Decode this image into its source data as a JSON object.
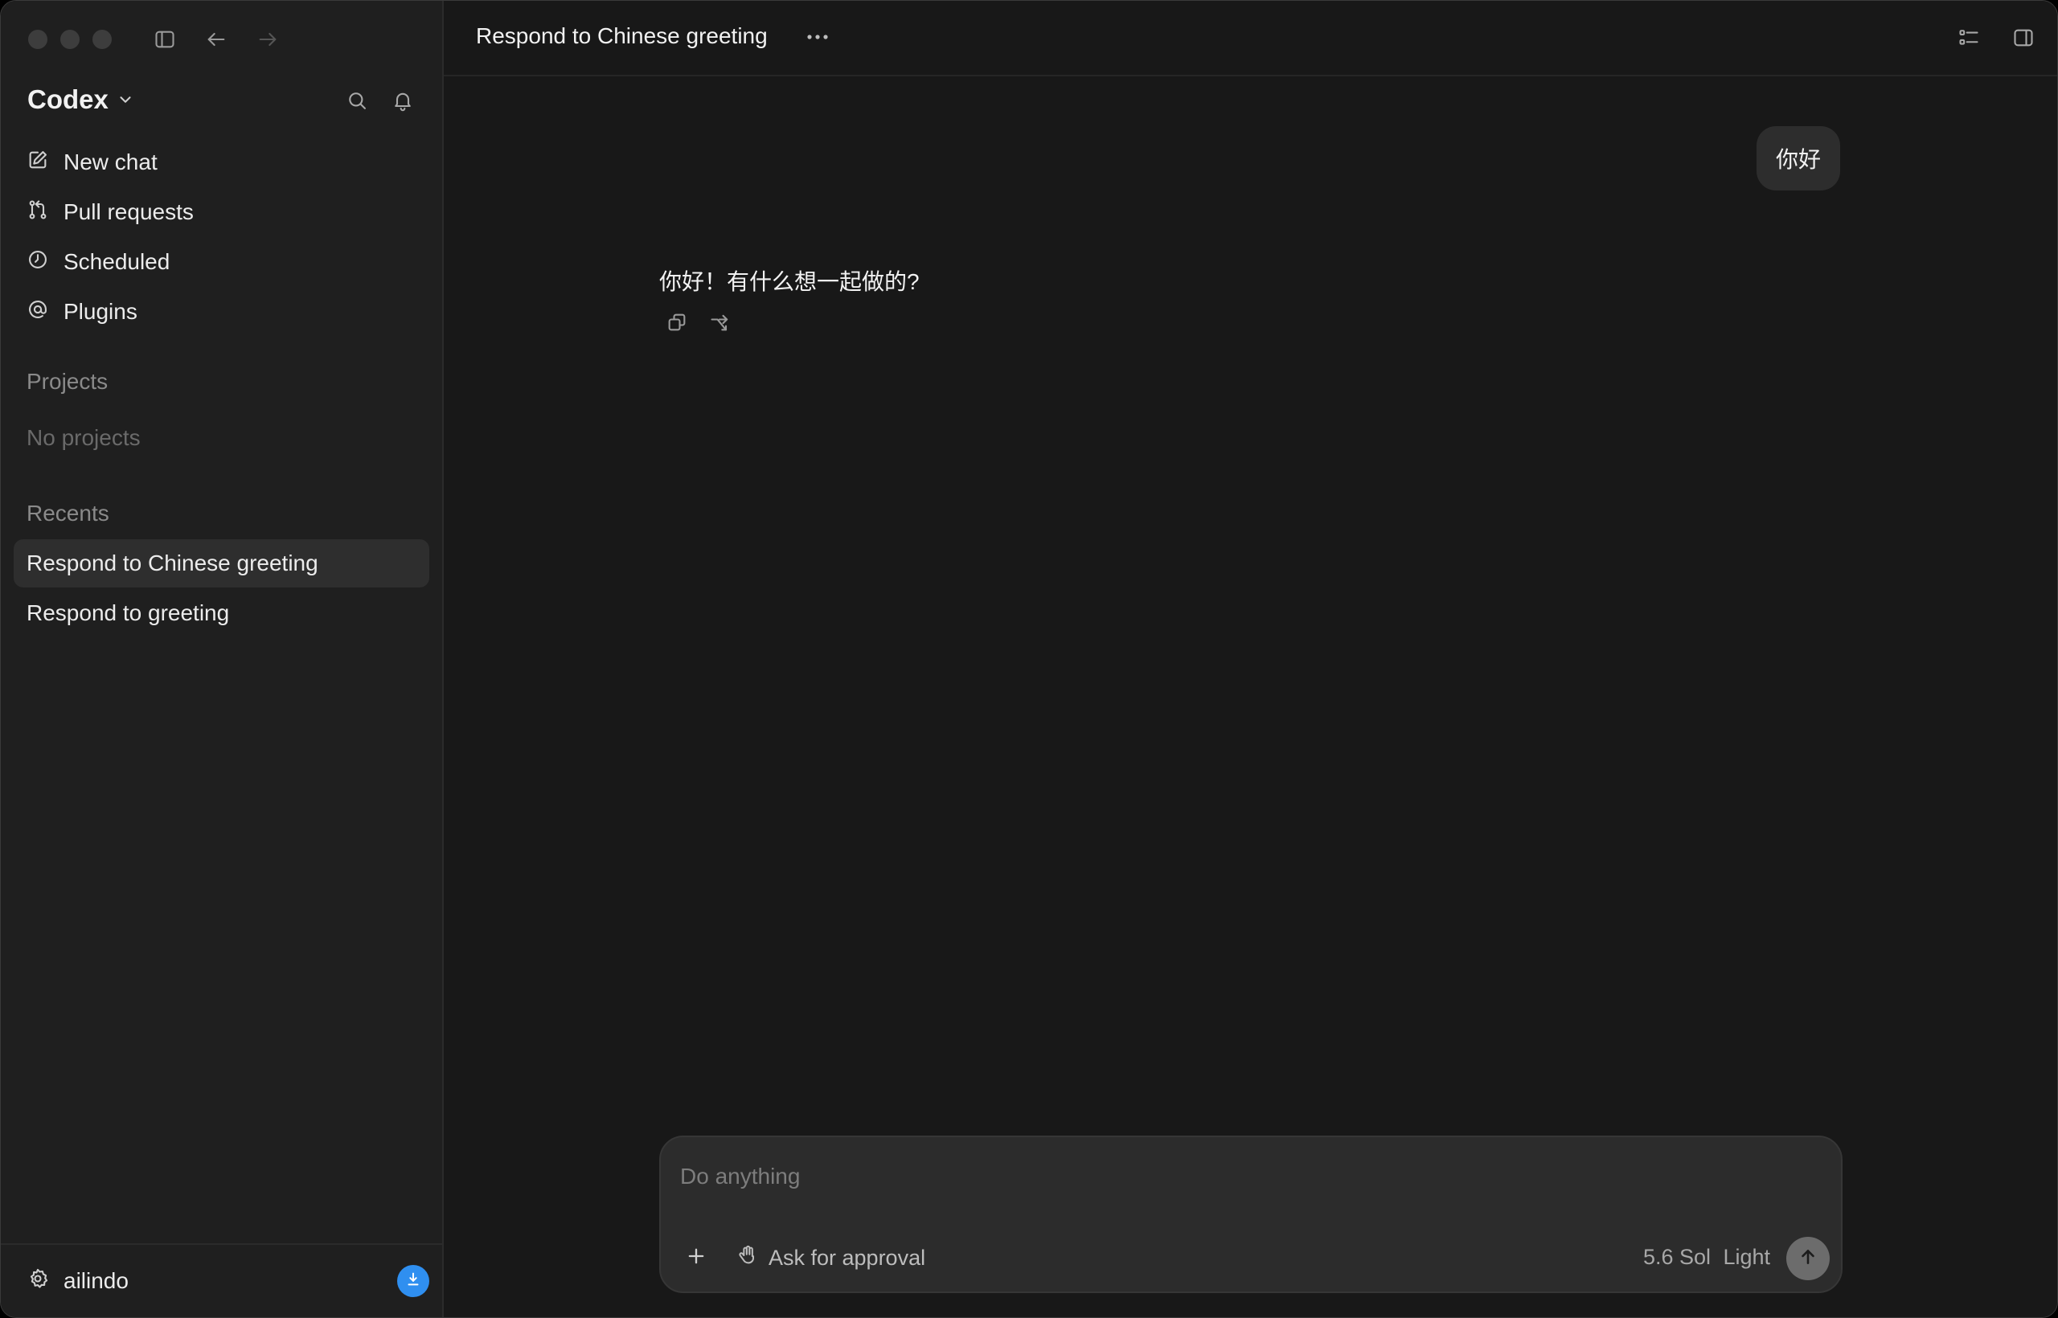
{
  "app": {
    "name": "Codex",
    "user_name": "ailindo"
  },
  "sidebar": {
    "nav": [
      {
        "label": "New chat",
        "icon": "edit-icon"
      },
      {
        "label": "Pull requests",
        "icon": "pull-request-icon"
      },
      {
        "label": "Scheduled",
        "icon": "clock-icon"
      },
      {
        "label": "Plugins",
        "icon": "at-sign-icon"
      }
    ],
    "projects_label": "Projects",
    "projects_empty": "No projects",
    "recents_label": "Recents",
    "recents": [
      {
        "label": "Respond to Chinese greeting",
        "active": true
      },
      {
        "label": "Respond to greeting",
        "active": false
      }
    ]
  },
  "chat": {
    "title": "Respond to Chinese greeting",
    "user_message": "你好",
    "assistant_message": "你好！有什么想一起做的?"
  },
  "composer": {
    "placeholder": "Do anything",
    "approval_label": "Ask for approval",
    "model_label": "5.6 Sol",
    "effort_label": "Light"
  },
  "colors": {
    "background": "#181818",
    "sidebar": "#1f1f1f",
    "accent": "#2f8ff0"
  }
}
